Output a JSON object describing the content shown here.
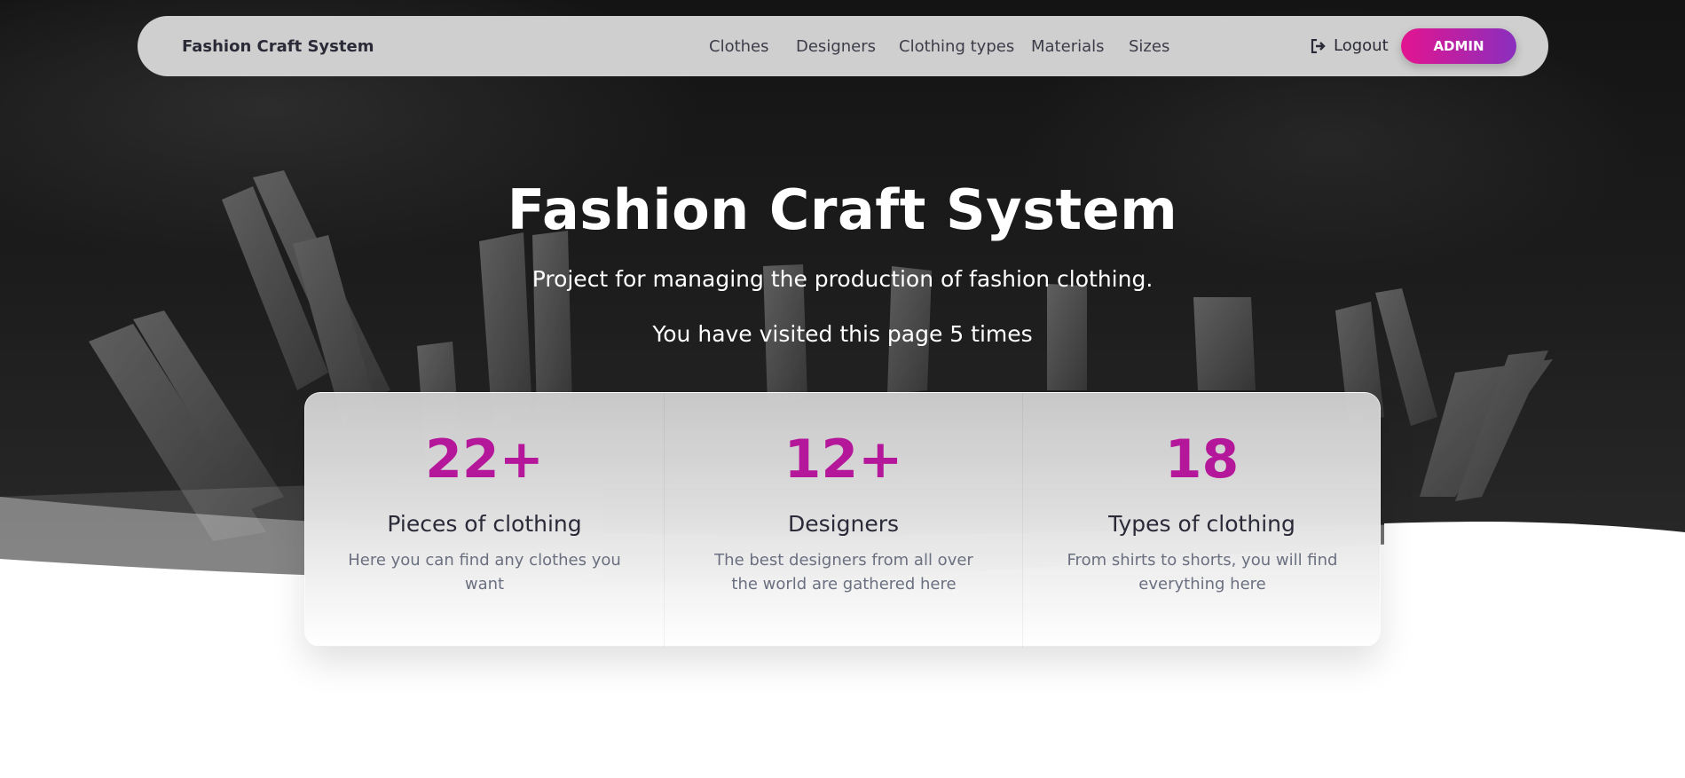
{
  "navbar": {
    "brand": "Fashion Craft System",
    "links": [
      {
        "label": "Clothes"
      },
      {
        "label": "Designers"
      },
      {
        "label": "Clothing types"
      },
      {
        "label": "Materials"
      },
      {
        "label": "Sizes"
      }
    ],
    "logout_label": "Logout",
    "logout_icon": "sign-out-icon",
    "admin_label": "ADMIN"
  },
  "hero": {
    "title": "Fashion Craft System",
    "subtitle": "Project for managing the production of fashion clothing.",
    "visits_text": "You have visited this page 5 times"
  },
  "stats": [
    {
      "value": "22+",
      "title": "Pieces of clothing",
      "description": "Here you can find any clothes you want"
    },
    {
      "value": "12+",
      "title": "Designers",
      "description": "The best designers from all over the world are gathered here"
    },
    {
      "value": "18",
      "title": "Types of clothing",
      "description": "From shirts to shorts, you will find everything here"
    }
  ],
  "colors": {
    "accent": "#b5179b",
    "button_gradient_start": "#e3148f",
    "button_gradient_end": "#8a2fbe",
    "navbar_bg": "#cfcfcf"
  }
}
